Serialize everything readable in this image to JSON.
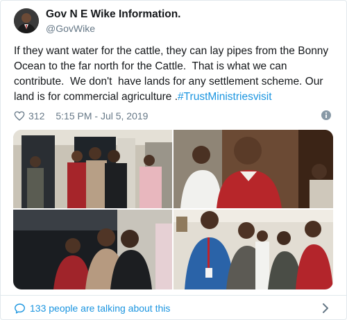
{
  "author": {
    "name": "Gov N E Wike Information.",
    "handle": "@GovWike"
  },
  "tweet": {
    "text": "If they want water for the cattle, they can lay pipes from the Bonny Ocean to the far north for the Cattle.  That is what we can contribute.  We don't  have lands for any settlement scheme. Our land is for commercial agriculture .",
    "hashtag": "#TrustMinistriesvisit"
  },
  "stats": {
    "likes": "312",
    "timestamp": "5:15 PM - Jul 5, 2019"
  },
  "footer": {
    "talking": "133 people are talking about this"
  },
  "colors": {
    "link": "#1b95e0",
    "muted": "#657786",
    "text": "#14171a",
    "border": "#e1e8ed"
  },
  "icons": {
    "like": "heart-icon",
    "info": "info-icon",
    "conversation": "speech-bubble-icon",
    "next": "chevron-right-icon"
  }
}
